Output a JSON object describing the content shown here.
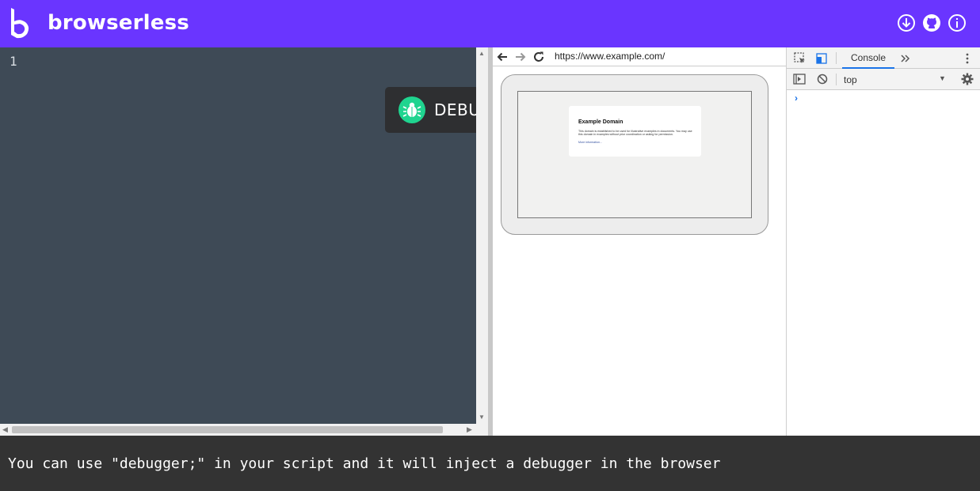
{
  "header": {
    "brand": "browserless",
    "download_icon": "download-icon",
    "github_icon": "github-icon",
    "info_icon": "info-icon"
  },
  "editor": {
    "line_numbers": [
      "1"
    ],
    "debug_button_label": "DEBUG"
  },
  "browser": {
    "url": "https://www.example.com/",
    "page": {
      "title": "Example Domain",
      "body": "This domain is established to be used for illustrative examples in documents. You may use this domain in examples without prior coordination or asking for permission.",
      "link": "More information..."
    }
  },
  "devtools": {
    "tab": "Console",
    "context": "top",
    "prompt": "›"
  },
  "footer": {
    "message": "You can use \"debugger;\" in your script and it will inject a debugger in the browser"
  },
  "colors": {
    "header_bg": "#6a35ff",
    "editor_bg": "#3e4a56",
    "debug_accent": "#1fd48f",
    "footer_bg": "#333333"
  }
}
